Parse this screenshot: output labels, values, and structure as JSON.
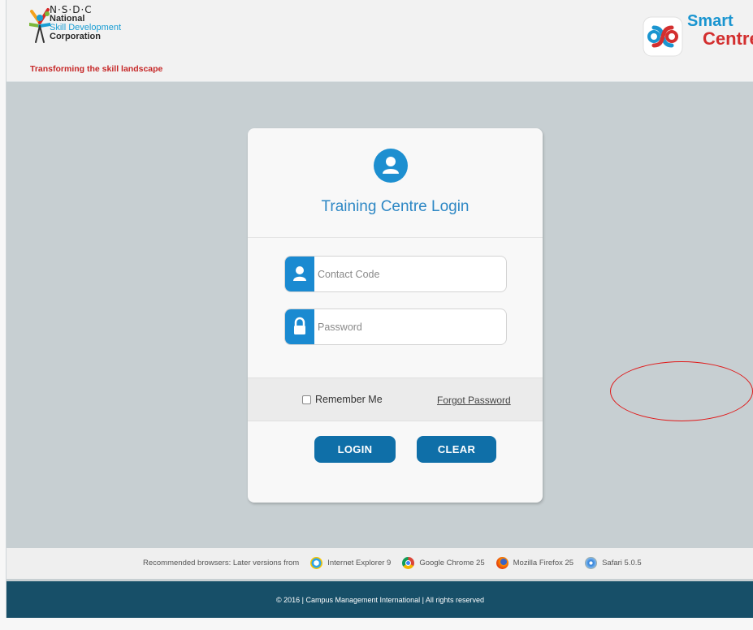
{
  "header": {
    "nsdc_brand": "N·S·D·C",
    "nsdc_line1": "National",
    "nsdc_line2": "Skill Development",
    "nsdc_line3": "Corporation",
    "tagline": "Transforming the skill landscape",
    "smart_line1": "Smart",
    "smart_line2": "Centre"
  },
  "login": {
    "title": "Training Centre Login",
    "contact_placeholder": "Contact Code",
    "password_placeholder": "Password",
    "remember_label": "Remember Me",
    "forgot_label": "Forgot Password",
    "login_label": "LOGIN",
    "clear_label": "CLEAR"
  },
  "browsers": {
    "intro": "Recommended browsers: Later versions from",
    "items": [
      {
        "label": "Internet Explorer 9",
        "icon": "ie-icon"
      },
      {
        "label": "Google Chrome 25",
        "icon": "chrome-icon"
      },
      {
        "label": "Mozilla Firefox 25",
        "icon": "firefox-icon"
      },
      {
        "label": "Safari 5.0.5",
        "icon": "safari-icon"
      }
    ]
  },
  "footer": {
    "text": "© 2016 | Campus Management International | All rights reserved"
  },
  "colors": {
    "primary": "#1a8ad1",
    "button": "#0f6fa8",
    "footer": "#174f68",
    "background": "#c7cfd2",
    "annotation": "#e01818"
  }
}
